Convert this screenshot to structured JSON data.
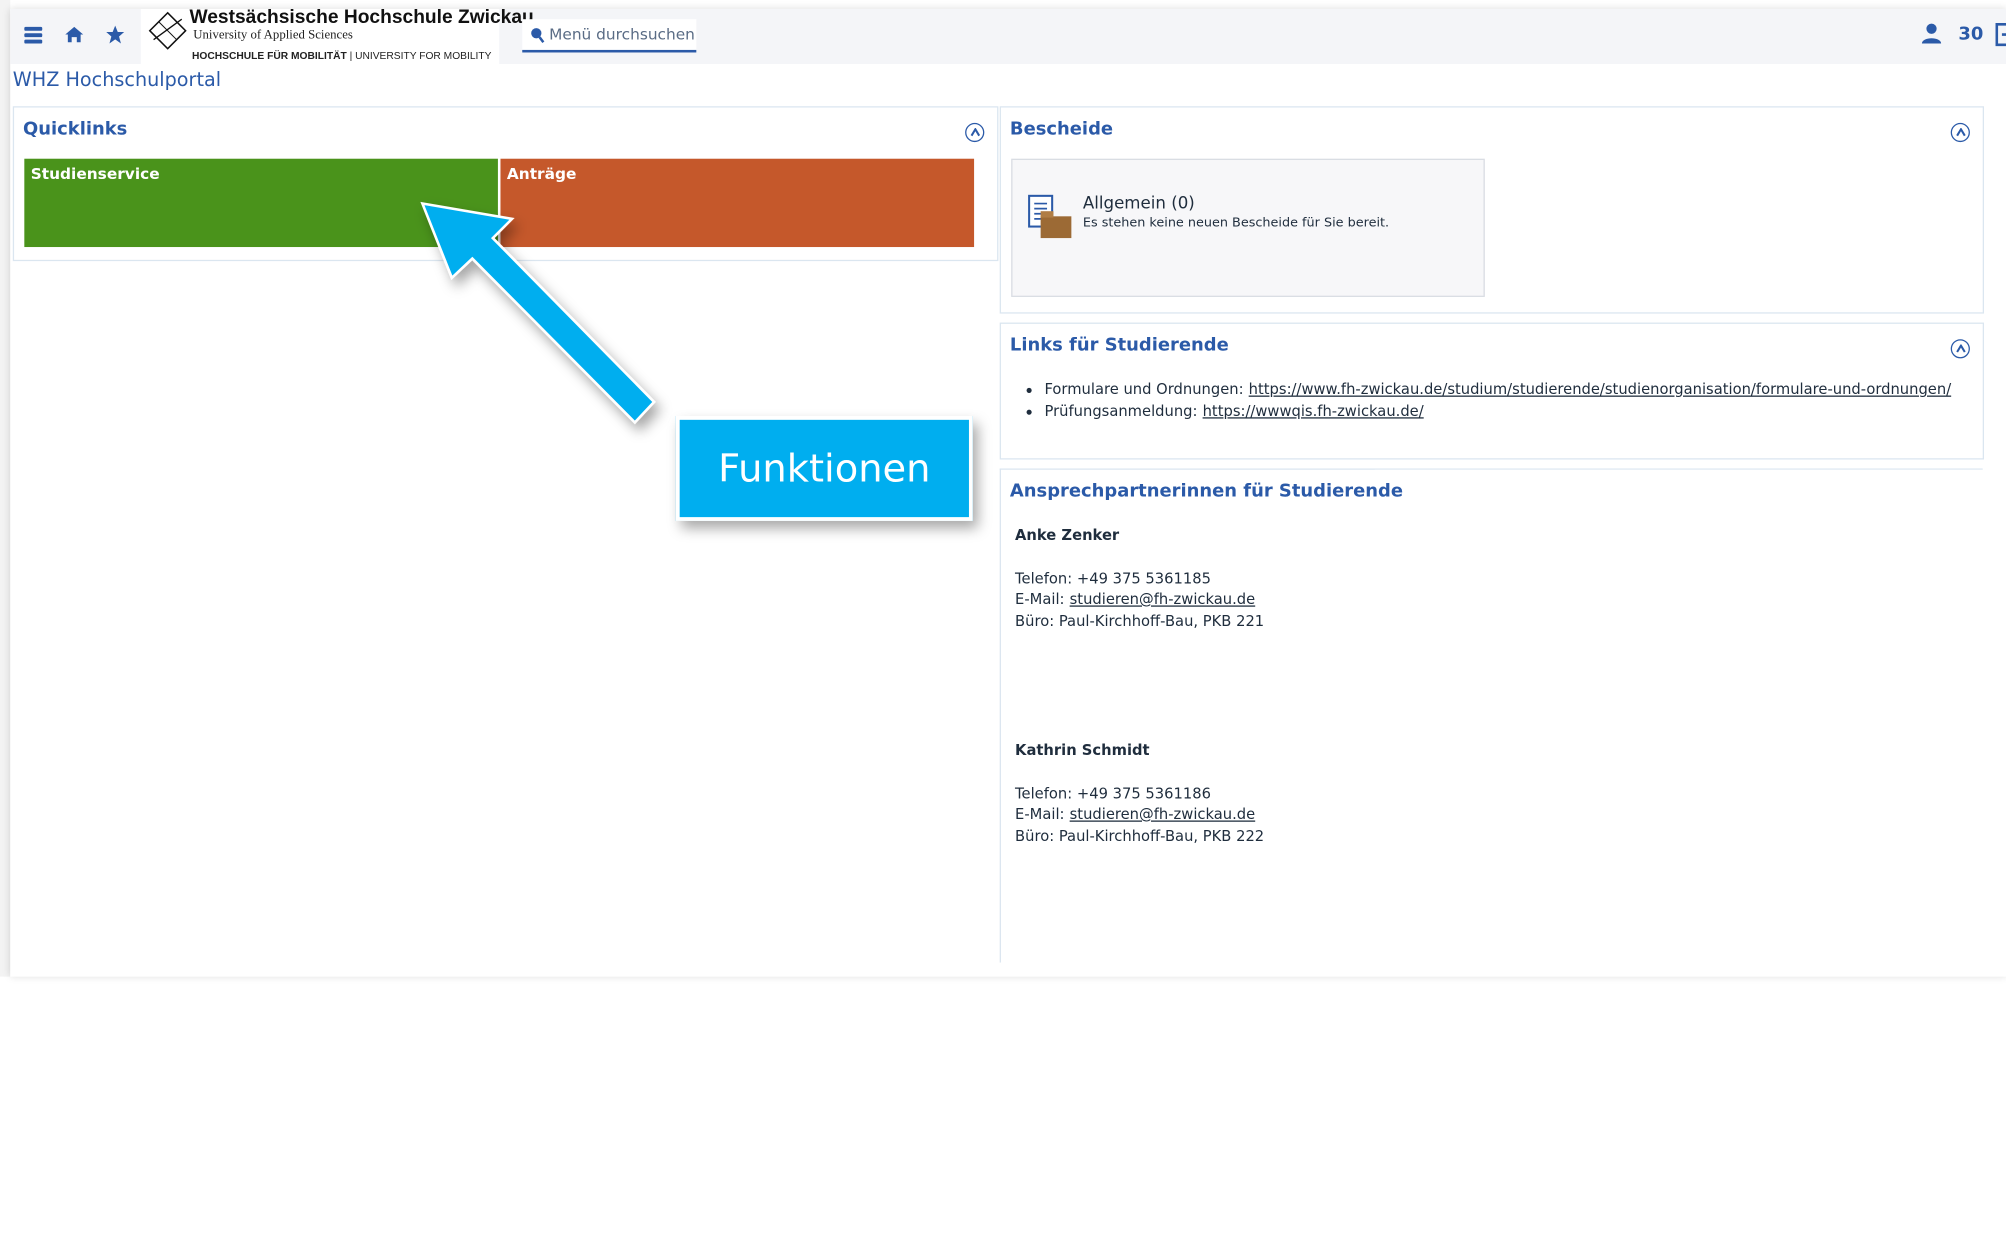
{
  "topbar": {
    "logo": {
      "line1": "Westsächsische Hochschule Zwickau",
      "line2": "University of Applied Sciences",
      "line3_bold": "HOCHSCHULE FÜR MOBILITÄT",
      "line3_rest": " | UNIVERSITY FOR MOBILITY"
    },
    "search_placeholder": "Menü durchsuchen",
    "user_count": "30",
    "icons": [
      "menu-icon",
      "home-icon",
      "star-icon",
      "search-icon",
      "user-icon",
      "logout-icon"
    ]
  },
  "portal_title": "WHZ Hochschulportal",
  "quicklinks": {
    "title": "Quicklinks",
    "tiles": [
      {
        "label": "Studienservice",
        "color": "#4a931b"
      },
      {
        "label": "Anträge",
        "color": "#c5582b"
      }
    ]
  },
  "bescheide": {
    "title": "Bescheide",
    "card_title": "Allgemein (0)",
    "card_text": "Es stehen keine neuen Bescheide für Sie bereit."
  },
  "links_studierende": {
    "title": "Links für Studierende",
    "items": [
      {
        "label": "Formulare und Ordnungen:",
        "url": "https://www.fh-zwickau.de/studium/studierende/studienorganisation/formulare-und-ordnungen/"
      },
      {
        "label": "Prüfungsanmeldung:",
        "url": "https://wwwqis.fh-zwickau.de/"
      }
    ]
  },
  "ansprechpartner": {
    "title": "Ansprechpartnerinnen für Studierende",
    "contacts": [
      {
        "name": "Anke Zenker",
        "phone": "Telefon: +49 375 5361185",
        "email_label": "E-Mail:",
        "email": "studieren@fh-zwickau.de",
        "office": "Büro: Paul-Kirchhoff-Bau, PKB 221"
      },
      {
        "name": "Kathrin Schmidt",
        "phone": "Telefon: +49 375 5361186",
        "email_label": "E-Mail:",
        "email": "studieren@fh-zwickau.de",
        "office": "Büro: Paul-Kirchhoff-Bau, PKB 222"
      }
    ]
  },
  "callout": {
    "label": "Funktionen",
    "color": "#00aeef"
  },
  "colors": {
    "accent": "#2b5aa8",
    "tile_green": "#4a931b",
    "tile_orange": "#c5582b"
  }
}
